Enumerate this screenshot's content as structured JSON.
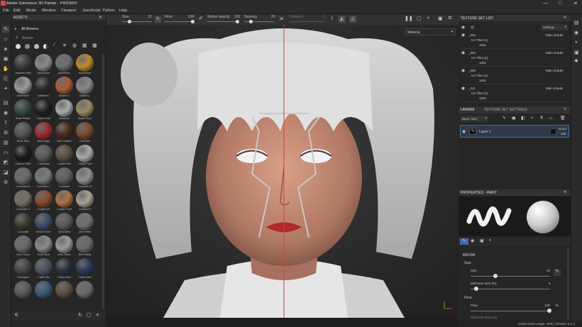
{
  "app": {
    "title": "Adobe Substance 3D Painter - PINTADO",
    "min": "—",
    "max": "□",
    "close": "✕"
  },
  "menu": [
    "File",
    "Edit",
    "Mode",
    "Window",
    "Viewport",
    "JavaScript",
    "Python",
    "Help"
  ],
  "toolbar": {
    "size_label": "Size",
    "size_value": "10",
    "flow_label": "Flow",
    "flow_value": "100",
    "stroke_opacity_label": "Stroke opacity",
    "stroke_opacity_value": "100",
    "spacing_label": "Spacing",
    "spacing_value": "20",
    "distance_label": "Distance",
    "distance_value": "1"
  },
  "viewport": {
    "mode_select": "Material",
    "accent": "#d24040"
  },
  "assets": {
    "header": "ASSETS",
    "library": "All libraries",
    "search_placeholder": "Search",
    "materials": [
      {
        "name": "Abstract Wall",
        "color": "#3c3c3c"
      },
      {
        "name": "Aluminium",
        "color": "#8a8a8a"
      },
      {
        "name": "Aluminium",
        "color": "#6f6f6f"
      },
      {
        "name": "Aluminium",
        "color": "#c08a2a"
      },
      {
        "name": "Aluminium",
        "color": "#9a9a9a"
      },
      {
        "name": "Artificial L",
        "color": "#2a2a2a"
      },
      {
        "name": "Autumn L",
        "color": "#b05a30"
      },
      {
        "name": "Baked Li",
        "color": "#888888"
      },
      {
        "name": "Base Plastic",
        "color": "#2f4a40"
      },
      {
        "name": "Black Coat",
        "color": "#1e1e1e"
      },
      {
        "name": "Blackout",
        "color": "#aaaaaa"
      },
      {
        "name": "Brass Pure",
        "color": "#9a8a60"
      },
      {
        "name": "Brick Ston",
        "color": "#555555"
      },
      {
        "name": "Bull Large",
        "color": "#a02a2a"
      },
      {
        "name": "Bull Leather",
        "color": "#4a2a1a"
      },
      {
        "name": "Calf Skin",
        "color": "#7a4a2a"
      },
      {
        "name": "Carbon Fiber",
        "color": "#1a1a1a"
      },
      {
        "name": "Chainmail",
        "color": "#5a5a5a"
      },
      {
        "name": "Coated Me",
        "color": "#5a5040"
      },
      {
        "name": "Cobalt Pure",
        "color": "#aaaaaa"
      },
      {
        "name": "Concrete B",
        "color": "#6a6a6a"
      },
      {
        "name": "Concrete C",
        "color": "#7a7a7a"
      },
      {
        "name": "Concrete",
        "color": "#5e5e5e"
      },
      {
        "name": "Concrete S",
        "color": "#909090"
      },
      {
        "name": "Concrete S",
        "color": "#756e65"
      },
      {
        "name": "Copper Br",
        "color": "#8a4a2a"
      },
      {
        "name": "Copper Pure",
        "color": "#b07040"
      },
      {
        "name": "Cracked P",
        "color": "#aaa090"
      },
      {
        "name": "Crocodile",
        "color": "#3a3a2a"
      },
      {
        "name": "Denim Rivet",
        "color": "#3a4a6a"
      },
      {
        "name": "Dirst Meta",
        "color": "#5a5a5a"
      },
      {
        "name": "Dirst Meta",
        "color": "#707070"
      },
      {
        "name": "Dmb Coba",
        "color": "#6a6a6a"
      },
      {
        "name": "Dmb Silve",
        "color": "#8a8a8a"
      },
      {
        "name": "Dmb Silver",
        "color": "#9a9a9a"
      },
      {
        "name": "Ebm Meta",
        "color": "#6a6a6a"
      },
      {
        "name": "Emergent",
        "color": "#444444"
      },
      {
        "name": "Fabric Ba",
        "color": "#4a5060"
      },
      {
        "name": "Fabric Bas",
        "color": "#2a3040"
      },
      {
        "name": "Fabric Den",
        "color": "#2a3a5a"
      },
      {
        "name": "",
        "color": "#5a5a5a"
      },
      {
        "name": "",
        "color": "#3a5a7a"
      },
      {
        "name": "",
        "color": "#5a5040"
      },
      {
        "name": "",
        "color": "#6a6a6a"
      }
    ]
  },
  "texture_sets": {
    "header": "TEXTURE SET LIST",
    "settings": "Settings",
    "items": [
      {
        "name": "_003",
        "shader": "Main shader",
        "uv": "UV Tiles (1)",
        "tile": "1001"
      },
      {
        "name": "_004",
        "shader": "Main shader",
        "uv": "UV Tiles (1)",
        "tile": "1001"
      },
      {
        "name": "_005",
        "shader": "Main shader",
        "uv": "UV Tiles (1)",
        "tile": "1001"
      },
      {
        "name": "_011",
        "shader": "Main shader",
        "uv": "UV Tiles (1)",
        "tile": "1001"
      }
    ]
  },
  "layers": {
    "tab_layers": "LAYERS",
    "tab_texture_settings": "TEXTURE SET SETTINGS",
    "channel": "Base color",
    "layer_name": "Layer 1",
    "blend": "Norm",
    "opacity": "100"
  },
  "properties": {
    "header": "PROPERTIES - PAINT",
    "brush": "BRUSH",
    "size_section": "Size",
    "size_label": "Size",
    "size_value": "10",
    "min_size_label": "Minimum Size (%)",
    "min_size_value": "5",
    "flow_section": "Flow",
    "flow_label": "Flow",
    "flow_value": "100",
    "min_flow_label": "Minimum Flow (%)"
  },
  "status": {
    "text": "Cache Disk Usage: 18% | Version: 8.1.3"
  }
}
